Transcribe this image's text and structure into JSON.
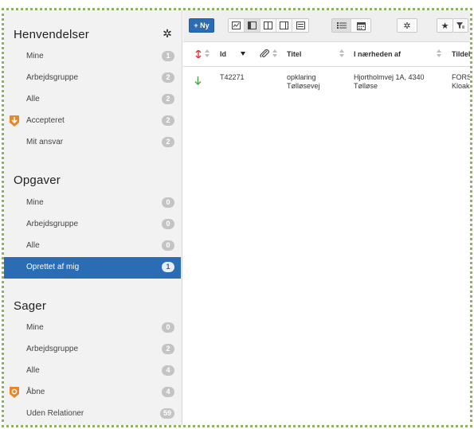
{
  "sidebar": {
    "sections": [
      {
        "title": "Henvendelser",
        "items": [
          {
            "label": "Mine",
            "count": "1"
          },
          {
            "label": "Arbejdsgruppe",
            "count": "2"
          },
          {
            "label": "Alle",
            "count": "2"
          },
          {
            "label": "Accepteret",
            "count": "2",
            "marker": "orange-down-arrow-icon"
          },
          {
            "label": "Mit ansvar",
            "count": "2"
          }
        ]
      },
      {
        "title": "Opgaver",
        "items": [
          {
            "label": "Mine",
            "count": "0"
          },
          {
            "label": "Arbejdsgruppe",
            "count": "0"
          },
          {
            "label": "Alle",
            "count": "0"
          },
          {
            "label": "Oprettet af mig",
            "count": "1",
            "active": true
          }
        ]
      },
      {
        "title": "Sager",
        "items": [
          {
            "label": "Mine",
            "count": "0"
          },
          {
            "label": "Arbejdsgruppe",
            "count": "2"
          },
          {
            "label": "Alle",
            "count": "4"
          },
          {
            "label": "Åbne",
            "count": "4",
            "marker": "orange-pin-icon"
          },
          {
            "label": "Uden Relationer",
            "count": "59"
          }
        ]
      }
    ]
  },
  "toolbar": {
    "new_label": "+ Ny"
  },
  "grid": {
    "columns": {
      "id": "Id",
      "title": "Titel",
      "nearby": "I nærheden af",
      "assigned": "Tildel"
    },
    "rows": [
      {
        "id": "T42271",
        "title_line1": "opklaring",
        "title_line2": "Tølløsevej",
        "nearby_line1": "Hjortholmvej 1A, 4340",
        "nearby_line2": "Tølløse",
        "assigned_line1": "FORS",
        "assigned_line2": "Kloaks"
      }
    ]
  },
  "colors": {
    "accent": "#2a6db5",
    "marker_orange": "#e8872a",
    "priority_red": "#d9343a",
    "row_arrow_green": "#4aa04a",
    "frame_border": "#8fae6a"
  }
}
